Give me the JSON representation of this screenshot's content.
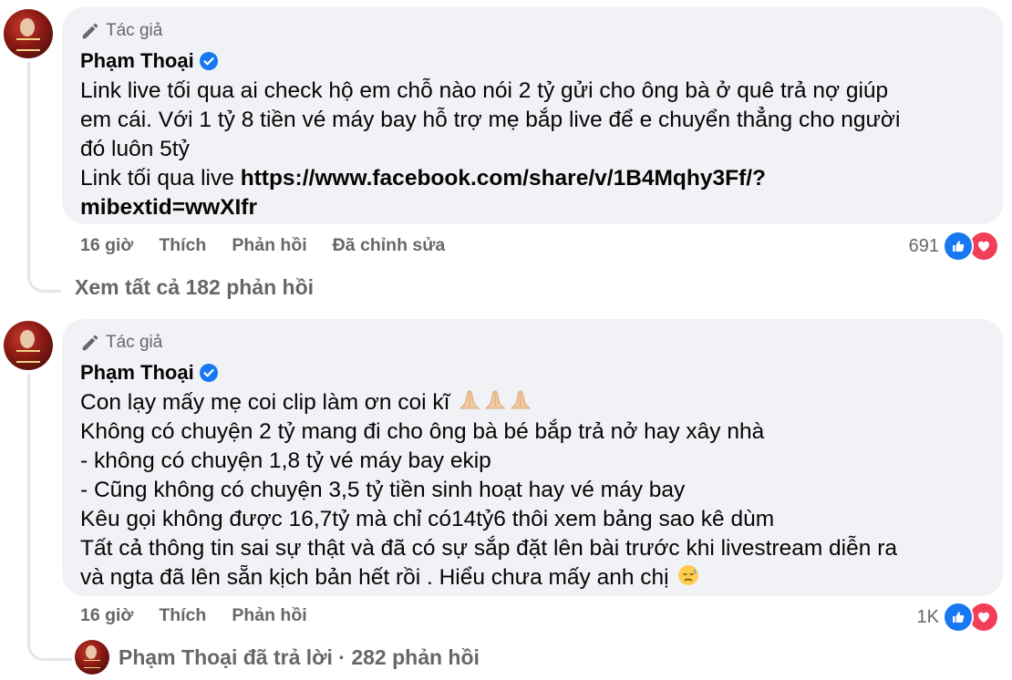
{
  "comments": [
    {
      "badge": "Tác giả",
      "name": "Phạm Thoại",
      "lines": [
        "Link live tối qua ai check hộ em chỗ nào nói 2 tỷ gửi cho ông bà ở quê trả nợ giúp",
        "em cái. Với 1 tỷ 8 tiền vé máy bay hỗ trợ mẹ bắp live để e chuyển thẳng cho người",
        "đó luôn 5tỷ",
        "Link tối qua live "
      ],
      "link_part1": "https://www.facebook.com/share/v/1B4Mqhy3Ff/?",
      "link_part2": "mibextid=wwXIfr",
      "time": "16 giờ",
      "like": "Thích",
      "reply": "Phản hồi",
      "edited": "Đã chỉnh sửa",
      "reaction_count": "691",
      "replies_link": "Xem tất cả 182 phản hồi"
    },
    {
      "badge": "Tác giả",
      "name": "Phạm Thoại",
      "lines": [
        "Con lạy mấy mẹ coi clip làm ơn coi kĩ ",
        "Không có chuyện 2 tỷ mang đi cho ông bà bé bắp trả nở hay xây nhà",
        "- không có chuyện 1,8 tỷ vé máy bay ekip",
        "- Cũng không có chuyện 3,5 tỷ tiền sinh hoạt hay vé máy bay",
        "Kêu gọi không được 16,7tỷ mà chỉ có14tỷ6 thôi xem bảng sao kê dùm",
        "Tất cả thông tin sai sự thật và đã có sự sắp đặt lên bài trước khi livestream diễn ra",
        "và ngta đã lên sẵn kịch bản hết rồi . Hiểu chưa mấy anh chị "
      ],
      "time": "16 giờ",
      "like": "Thích",
      "reply": "Phản hồi",
      "reaction_count": "1K",
      "replies_link": "Phạm Thoại đã trả lời · 282 phản hồi"
    }
  ],
  "icons": {
    "author": "pencil-icon",
    "verified": "verified-badge-icon",
    "like_reaction": "like-reaction-icon",
    "love_reaction": "love-reaction-icon",
    "pray_emoji": "folded-hands-emoji",
    "sad_emoji": "downcast-face-emoji"
  },
  "colors": {
    "bubble": "#f0f2f5",
    "meta": "#65676b",
    "like": "#1877f2",
    "love": "#f33e58",
    "verified": "#1877f2"
  }
}
